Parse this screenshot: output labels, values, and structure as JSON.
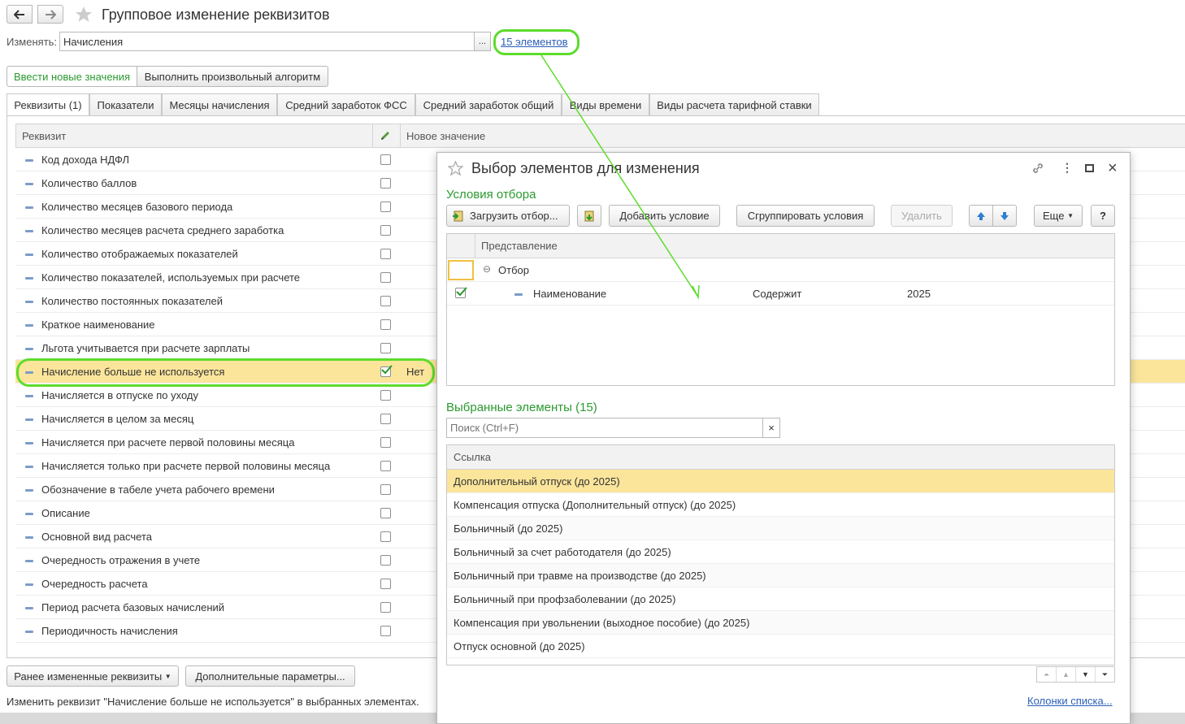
{
  "window": {
    "title": "Групповое изменение реквизитов"
  },
  "change_field": {
    "label": "Изменять:",
    "value": "Начисления",
    "select_button": "...",
    "elements_link": "15 элементов"
  },
  "mode_buttons": [
    "Ввести новые значения",
    "Выполнить произвольный алгоритм"
  ],
  "tabs": [
    "Реквизиты (1)",
    "Показатели",
    "Месяцы начисления",
    "Средний заработок ФСС",
    "Средний заработок общий",
    "Виды времени",
    "Виды расчета тарифной ставки"
  ],
  "grid": {
    "col_attribute": "Реквизит",
    "col_new_value": "Новое значение",
    "rows": [
      {
        "label": "Код дохода НДФЛ",
        "checked": false,
        "value": ""
      },
      {
        "label": "Количество баллов",
        "checked": false,
        "value": ""
      },
      {
        "label": "Количество месяцев базового периода",
        "checked": false,
        "value": ""
      },
      {
        "label": "Количество месяцев расчета среднего заработка",
        "checked": false,
        "value": ""
      },
      {
        "label": "Количество отображаемых показателей",
        "checked": false,
        "value": ""
      },
      {
        "label": "Количество показателей, используемых при расчете",
        "checked": false,
        "value": ""
      },
      {
        "label": "Количество постоянных показателей",
        "checked": false,
        "value": ""
      },
      {
        "label": "Краткое наименование",
        "checked": false,
        "value": ""
      },
      {
        "label": "Льгота учитывается при расчете зарплаты",
        "checked": false,
        "value": ""
      },
      {
        "label": "Начисление больше не используется",
        "checked": true,
        "value": "Нет"
      },
      {
        "label": "Начисляется в отпуске по уходу",
        "checked": false,
        "value": ""
      },
      {
        "label": "Начисляется в целом за месяц",
        "checked": false,
        "value": ""
      },
      {
        "label": "Начисляется при расчете первой половины месяца",
        "checked": false,
        "value": ""
      },
      {
        "label": "Начисляется только при расчете первой половины месяца",
        "checked": false,
        "value": ""
      },
      {
        "label": "Обозначение в табеле учета рабочего времени",
        "checked": false,
        "value": ""
      },
      {
        "label": "Описание",
        "checked": false,
        "value": ""
      },
      {
        "label": "Основной вид расчета",
        "checked": false,
        "value": ""
      },
      {
        "label": "Очередность отражения в учете",
        "checked": false,
        "value": ""
      },
      {
        "label": "Очередность расчета",
        "checked": false,
        "value": ""
      },
      {
        "label": "Период расчета базовых начислений",
        "checked": false,
        "value": ""
      },
      {
        "label": "Периодичность начисления",
        "checked": false,
        "value": ""
      }
    ]
  },
  "bottom_buttons": {
    "previous": "Ранее измененные реквизиты",
    "extra": "Дополнительные параметры..."
  },
  "status": "Изменить реквизит \"Начисление больше не используется\" в выбранных элементах.",
  "dialog": {
    "title": "Выбор элементов для изменения",
    "filter_section": "Условия отбора",
    "toolbar": {
      "load": "Загрузить отбор...",
      "add": "Добавить условие",
      "group": "Сгруппировать условия",
      "delete": "Удалить",
      "more": "Еще",
      "help": "?"
    },
    "filter_header": "Представление",
    "filter_root": "Отбор",
    "filter_row": {
      "field": "Наименование",
      "condition": "Содержит",
      "value": "2025",
      "checked": true
    },
    "selected_section": "Выбранные элементы (15)",
    "search_placeholder": "Поиск (Ctrl+F)",
    "search_clear": "×",
    "list_header": "Ссылка",
    "items": [
      "Дополнительный отпуск (до 2025)",
      "Компенсация отпуска (Дополнительный отпуск) (до 2025)",
      "Больничный (до 2025)",
      "Больничный за счет работодателя (до 2025)",
      "Больничный при травме на производстве (до 2025)",
      "Больничный при профзаболевании (до 2025)",
      "Компенсация при увольнении (выходное пособие) (до 2025)",
      "Отпуск основной (до 2025)"
    ],
    "columns_link": "Колонки списка..."
  },
  "colors": {
    "accent_green": "#2a9a2f",
    "highlight_yellow": "#fbe59b",
    "annotation_green": "#5ddc2c"
  }
}
